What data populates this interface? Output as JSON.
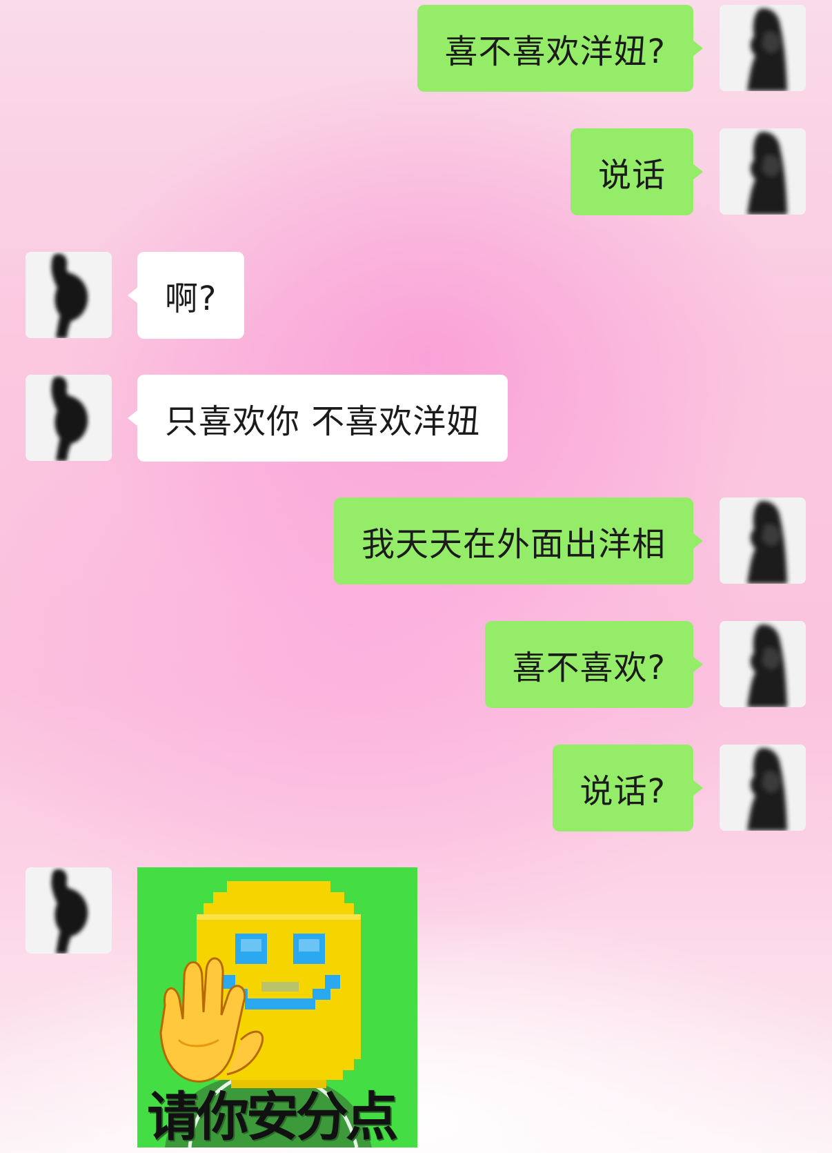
{
  "messages": [
    {
      "side": "out",
      "text": "喜不喜欢洋妞?",
      "avatar_icon": "woman-silhouette-avatar"
    },
    {
      "side": "out",
      "text": "说话",
      "avatar_icon": "woman-silhouette-avatar"
    },
    {
      "side": "in",
      "text": "啊?",
      "avatar_icon": "man-silhouette-avatar"
    },
    {
      "side": "in",
      "text": "只喜欢你 不喜欢洋妞",
      "avatar_icon": "man-silhouette-avatar"
    },
    {
      "side": "out",
      "text": "我天天在外面出洋相",
      "avatar_icon": "woman-silhouette-avatar"
    },
    {
      "side": "out",
      "text": "喜不喜欢?",
      "avatar_icon": "woman-silhouette-avatar"
    },
    {
      "side": "out",
      "text": "说话?",
      "avatar_icon": "woman-silhouette-avatar"
    }
  ],
  "sticker": {
    "side": "in",
    "caption": "请你安分点",
    "icon": "pixel-smiley-waving-hand-sticker",
    "avatar_icon": "man-silhouette-avatar"
  },
  "colors": {
    "outgoing_bubble": "#95ec69",
    "incoming_bubble": "#ffffff",
    "sticker_background": "#44dd44",
    "smiley_face": "#f5d400",
    "smiley_features": "#2aa8f0"
  }
}
